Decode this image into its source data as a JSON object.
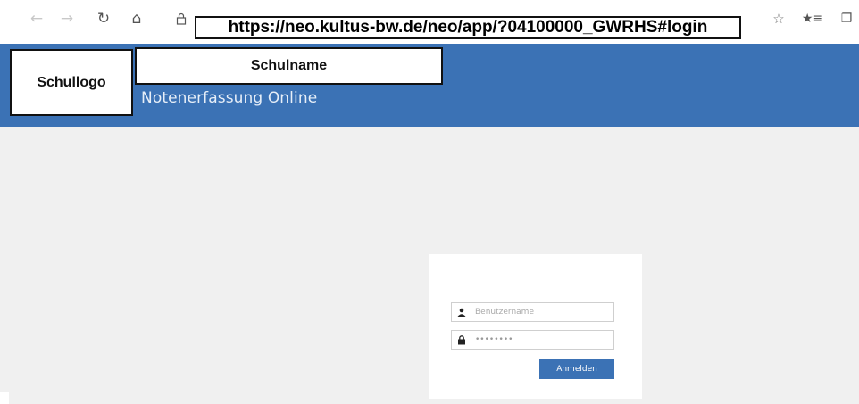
{
  "browser": {
    "url": "https://neo.kultus-bw.de/neo/app/?04100000_GWRHS#login",
    "icons": {
      "back": "arrow-left-icon",
      "forward": "arrow-right-icon",
      "refresh": "refresh-icon",
      "home": "home-icon",
      "lock": "lock-icon",
      "favorite": "star-icon",
      "favorites_list": "favorites-icon",
      "collections": "collections-icon"
    }
  },
  "header": {
    "logo_placeholder": "Schullogo",
    "school_name_placeholder": "Schulname",
    "app_title": "Notenerfassung Online",
    "background_color": "#3b72b5"
  },
  "login": {
    "username_placeholder": "Benutzername",
    "password_value": "••••••••",
    "submit_label": "Anmelden",
    "user_icon": "user-icon",
    "lock_icon": "lock-icon"
  }
}
